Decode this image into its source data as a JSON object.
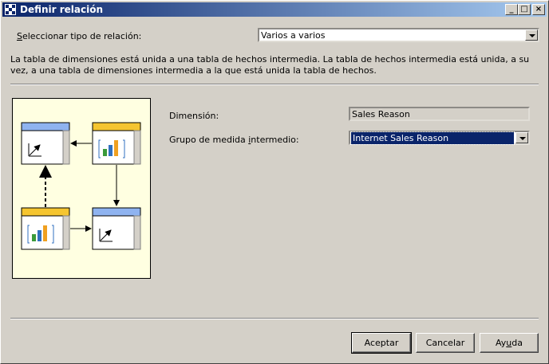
{
  "window": {
    "title": "Definir relación"
  },
  "relation_type": {
    "label": "Seleccionar tipo de relación:",
    "value": "Varios a varios"
  },
  "description": "La tabla de dimensiones está unida a una tabla de hechos intermedia. La tabla de hechos intermedia está unida, a su vez, a una tabla de dimensiones intermedia a la que está unida la tabla de hechos.",
  "dimension": {
    "label": "Dimensión:",
    "value": "Sales Reason"
  },
  "measure_group": {
    "label": "Grupo de medida intermedio:",
    "value": "Internet Sales Reason"
  },
  "buttons": {
    "ok": "Aceptar",
    "cancel": "Cancelar",
    "help": "Ayuda"
  },
  "colors": {
    "dimension_header": "#8fb3f0",
    "fact_header": "#f5c530",
    "diagram_bg": "#ffffe1",
    "selection": "#0a246a"
  },
  "icons": [
    "window-icon",
    "minimize-icon",
    "maximize-icon",
    "close-icon",
    "dimension-chart-icon",
    "fact-bar-chart-icon"
  ]
}
